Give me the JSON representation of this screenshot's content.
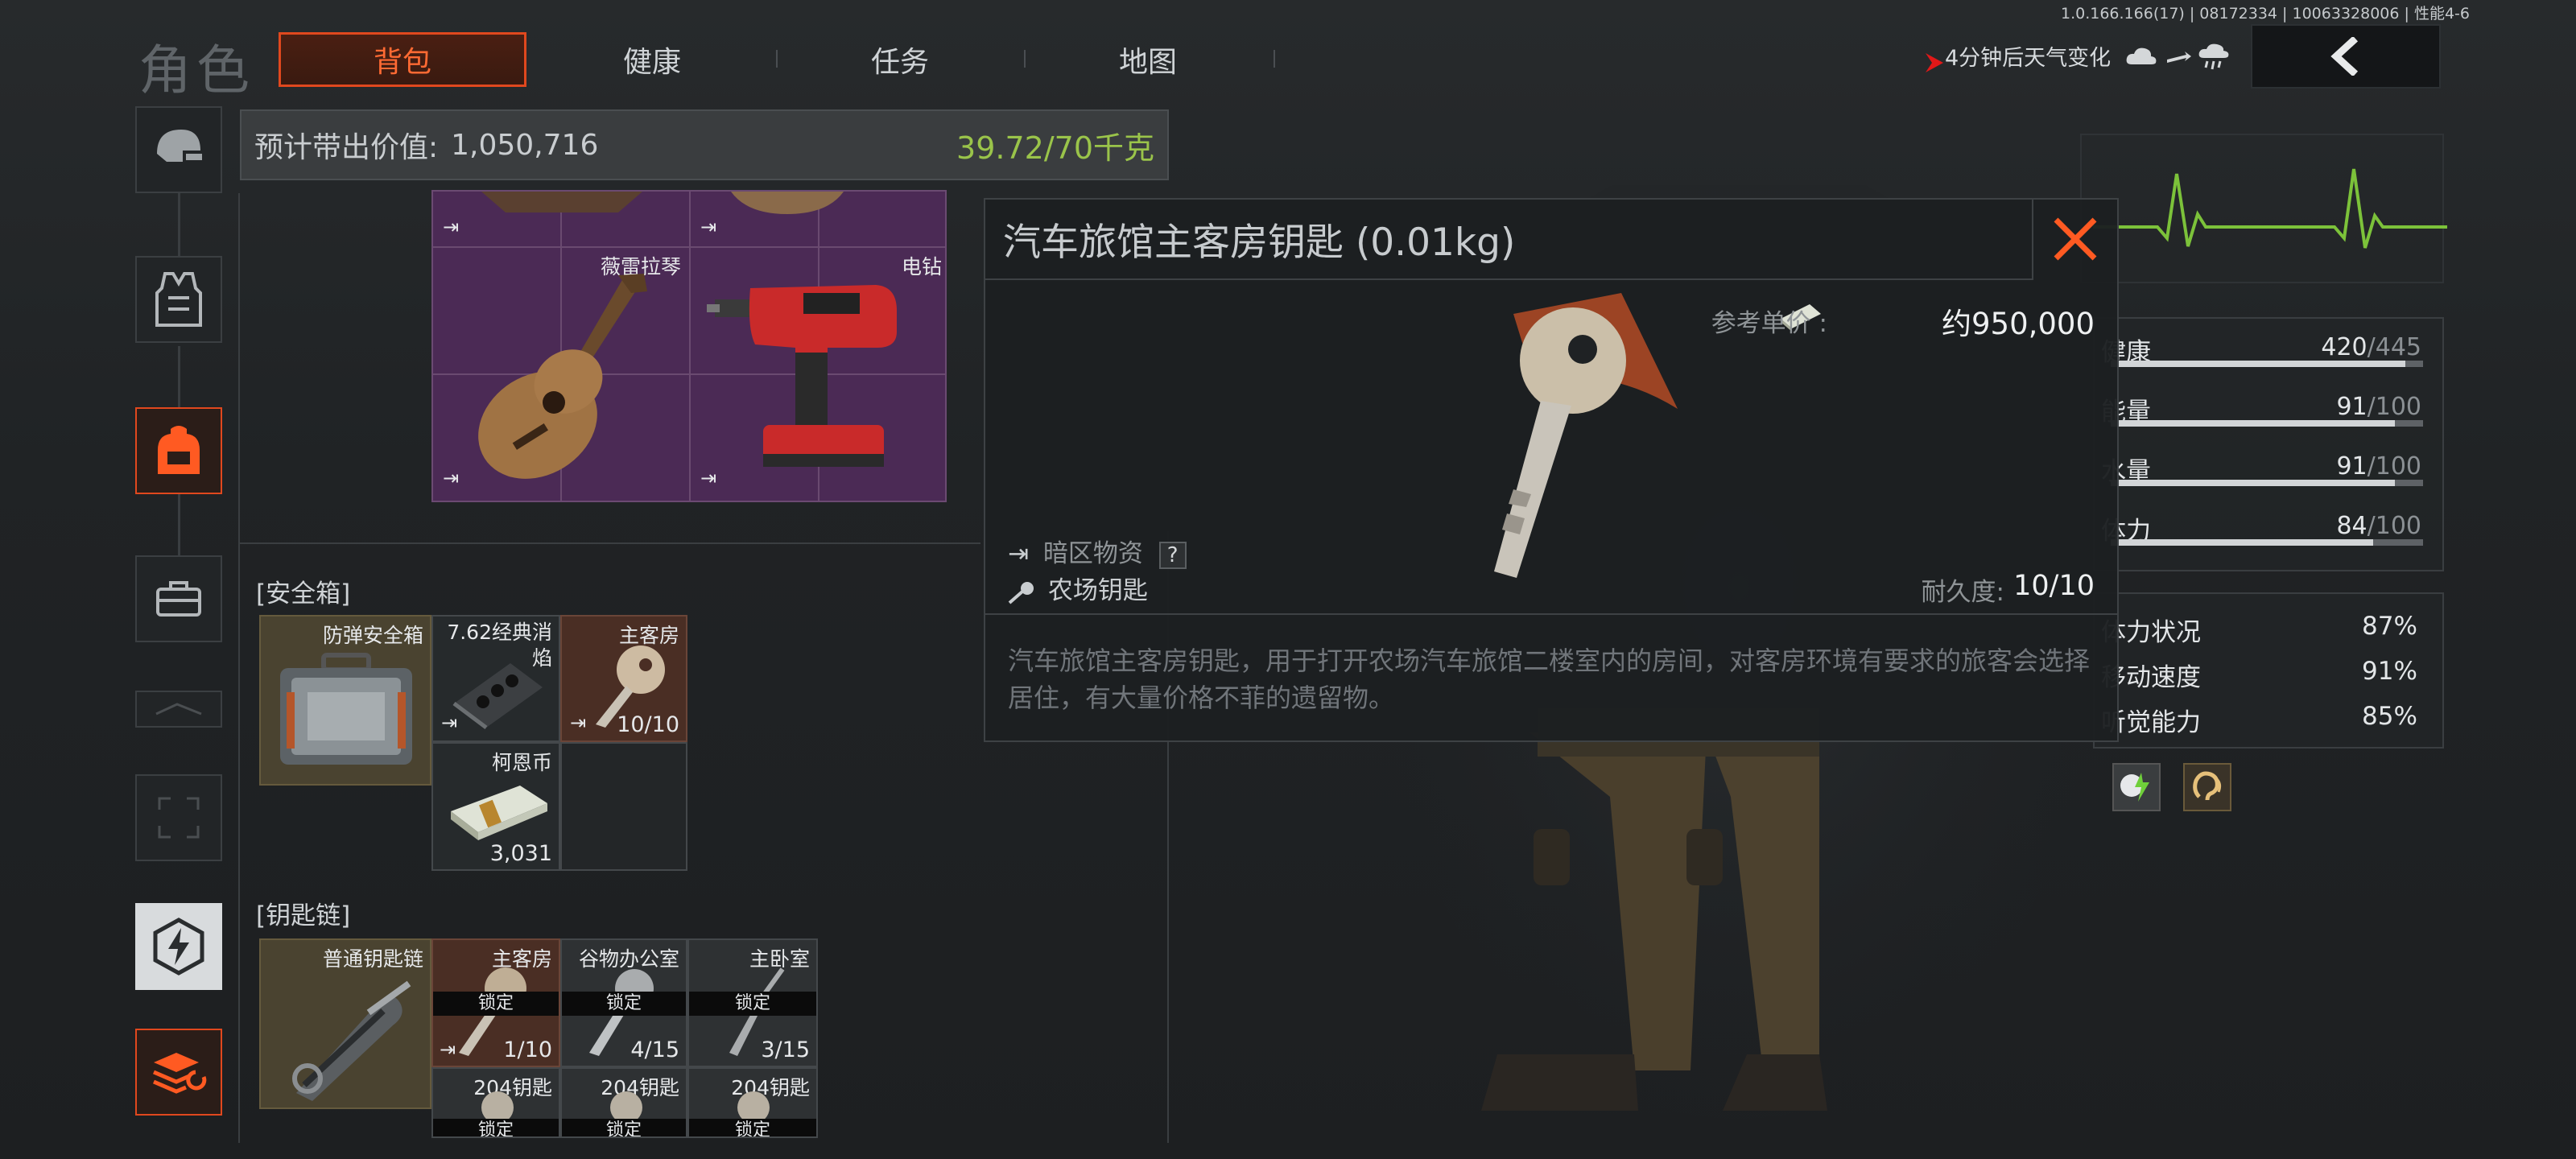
{
  "header": {
    "title": "角色",
    "tabs": [
      {
        "label": "背包",
        "active": true
      },
      {
        "label": "健康",
        "active": false
      },
      {
        "label": "任务",
        "active": false
      },
      {
        "label": "地图",
        "active": false
      }
    ],
    "version": "1.0.166.166(17) | 08172334 | 10063328006 | 性能4-6",
    "weather_text": "4分钟后天气变化",
    "weather_icons": [
      "cloud-icon",
      "wind-icon",
      "rain-cloud-icon"
    ],
    "back_icon": "chevron-left-icon"
  },
  "nav": {
    "items": [
      "helmet-icon",
      "vest-icon",
      "backpack-icon",
      "toolbox-icon",
      "slot-icon",
      "expand-icon",
      "skill-icon",
      "layers-icon"
    ]
  },
  "value_bar": {
    "label": "预计带出价值:",
    "value": "1,050,716",
    "weight": "39.72/70千克"
  },
  "backpack": {
    "items": [
      {
        "name": "薇雷拉琴"
      },
      {
        "name": "电钻"
      }
    ]
  },
  "safe_box": {
    "title": "[安全箱]",
    "container": "防弹安全箱",
    "items": [
      {
        "name": "7.62经典消焰",
        "count": ""
      },
      {
        "name": "主客房",
        "count": "10/10"
      },
      {
        "name": "柯恩币",
        "count": "3,031"
      }
    ]
  },
  "keychain": {
    "title": "[钥匙链]",
    "container": "普通钥匙链",
    "lock_label": "锁定",
    "row1": [
      {
        "name": "主客房",
        "count": "1/10"
      },
      {
        "name": "谷物办公室",
        "count": "4/15"
      },
      {
        "name": "主卧室",
        "count": "3/15"
      }
    ],
    "row2": [
      {
        "name": "204钥匙"
      },
      {
        "name": "204钥匙"
      },
      {
        "name": "204钥匙"
      }
    ]
  },
  "popup": {
    "title": "汽车旅馆主客房钥匙 (0.01kg)",
    "price_label": "参考单价 :",
    "price_value": "约950,000",
    "tag1": "暗区物资",
    "tag1_help": "?",
    "tag2": "农场钥匙",
    "durability_label": "耐久度:",
    "durability_value": "10/10",
    "description": "汽车旅馆主客房钥匙，用于打开农场汽车旅馆二楼室内的房间，对客房环境有要求的旅客会选择居住，有大量价格不菲的遗留物。"
  },
  "stats": {
    "bars": [
      {
        "label": "健康",
        "value": "420",
        "max": "/445",
        "fraction": 0.944
      },
      {
        "label": "能量",
        "value": "91",
        "max": "/100",
        "fraction": 0.91
      },
      {
        "label": "水量",
        "value": "91",
        "max": "/100",
        "fraction": 0.91
      },
      {
        "label": "体力",
        "value": "84",
        "max": "/100",
        "fraction": 0.84
      }
    ],
    "percents": [
      {
        "label": "体力状况",
        "value": "87%"
      },
      {
        "label": "移动速度",
        "value": "91%"
      },
      {
        "label": "听觉能力",
        "value": "85%"
      }
    ],
    "buff_icons": [
      "stamina-buff-icon",
      "hearing-buff-icon"
    ]
  },
  "colors": {
    "accent": "#e0481e",
    "weight_green": "#9ac44a",
    "heartbeat": "#7cc23a",
    "locked_bg": "#0b0b0b"
  }
}
